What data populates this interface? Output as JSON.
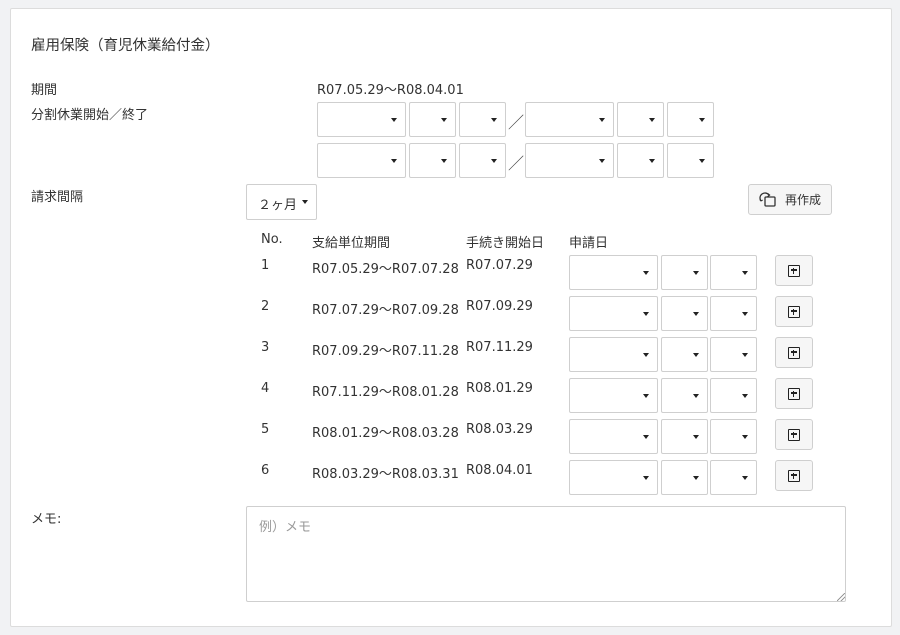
{
  "section_title": "雇用保険（育児休業給付金）",
  "period": {
    "label": "期間",
    "value": "R07.05.29〜R08.04.01"
  },
  "split_leave": {
    "label": "分割休業開始／終了",
    "separator": "／"
  },
  "interval": {
    "label": "請求間隔",
    "selected": "２ヶ月"
  },
  "recreate_button": {
    "label": "再作成",
    "icon": "refresh-copy-icon"
  },
  "table": {
    "headers": [
      "No.",
      "支給単位期間",
      "手続き開始日",
      "申請日"
    ],
    "rows": [
      {
        "no": "1",
        "period": "R07.05.29〜R07.07.28",
        "start": "R07.07.29"
      },
      {
        "no": "2",
        "period": "R07.07.29〜R07.09.28",
        "start": "R07.09.29"
      },
      {
        "no": "3",
        "period": "R07.09.29〜R07.11.28",
        "start": "R07.11.29"
      },
      {
        "no": "4",
        "period": "R07.11.29〜R08.01.28",
        "start": "R08.01.29"
      },
      {
        "no": "5",
        "period": "R08.01.29〜R08.03.28",
        "start": "R08.03.29"
      },
      {
        "no": "6",
        "period": "R08.03.29〜R08.03.31",
        "start": "R08.04.01"
      }
    ]
  },
  "memo": {
    "label": "メモ:",
    "placeholder": "例）メモ"
  }
}
